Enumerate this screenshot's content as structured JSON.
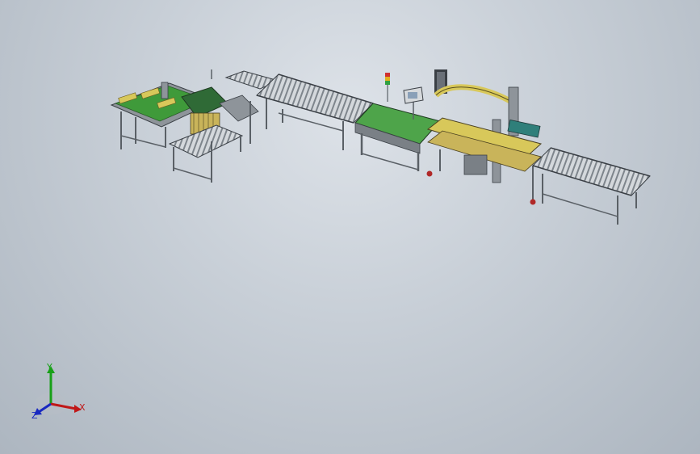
{
  "view": {
    "background_top": "#dde2e8",
    "background_bottom": "#adb6c0"
  },
  "model": {
    "frame_color": "#8e949a",
    "frame_dark": "#3a3f45",
    "roller_color": "#c9ced3",
    "belt_green": "#3f9a3a",
    "accent_yellow": "#d8c85a",
    "caster_red": "#b02828",
    "stack_light_colors": [
      "#d03030",
      "#e0b020",
      "#30a040"
    ]
  },
  "triad": {
    "x_label": "X",
    "y_label": "Y",
    "z_label": "Z",
    "x_color": "#c01818",
    "y_color": "#18a018",
    "z_color": "#1828c0"
  }
}
